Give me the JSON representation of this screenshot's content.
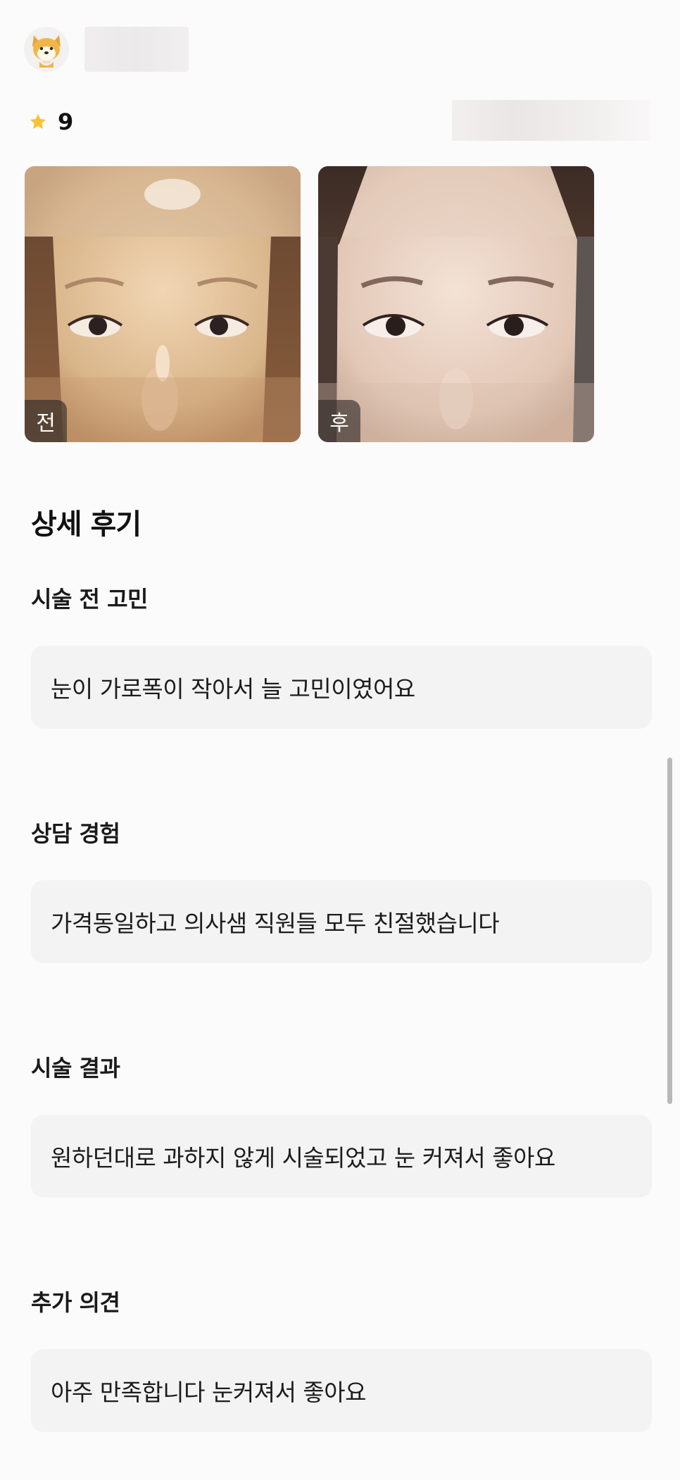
{
  "rating": {
    "value": "9"
  },
  "photos": [
    {
      "label": "전"
    },
    {
      "label": "후"
    }
  ],
  "detail": {
    "section_title": "상세 후기",
    "items": [
      {
        "question": "시술 전 고민",
        "answer": "눈이 가로폭이 작아서 늘 고민이였어요"
      },
      {
        "question": "상담 경험",
        "answer": "가격동일하고 의사샘 직원들 모두 친절했습니다"
      },
      {
        "question": "시술 결과",
        "answer": "원하던대로 과하지 않게 시술되었고 눈 커져서 좋아요"
      },
      {
        "question": "추가 의견",
        "answer": "아주 만족합니다 눈커져서 좋아요"
      }
    ]
  },
  "colors": {
    "star": "#f7c332",
    "answer_bg": "#f4f3f4",
    "label_bg": "#2d2826"
  },
  "icons": {
    "avatar": "shiba-dog-avatar-icon",
    "star": "star-icon"
  }
}
